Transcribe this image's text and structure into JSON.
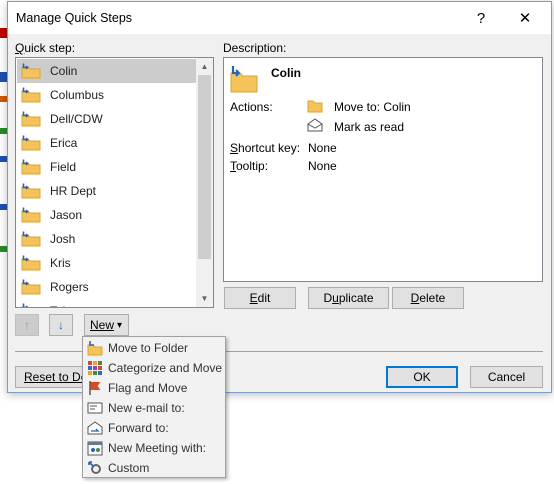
{
  "dialog": {
    "title": "Manage Quick Steps",
    "help_glyph": "?",
    "close_glyph": "✕"
  },
  "left": {
    "label_prefix": "",
    "label_hotkey": "Q",
    "label_rest": "uick step:",
    "items": [
      {
        "label": "Colin",
        "selected": true
      },
      {
        "label": "Columbus"
      },
      {
        "label": "Dell/CDW"
      },
      {
        "label": "Erica"
      },
      {
        "label": "Field"
      },
      {
        "label": "HR Dept"
      },
      {
        "label": "Jason"
      },
      {
        "label": "Josh"
      },
      {
        "label": "Kris"
      },
      {
        "label": "Rogers"
      },
      {
        "label": "Tobe"
      }
    ],
    "scroll_up": "▲",
    "scroll_down": "▼",
    "move_up_glyph": "↑",
    "move_down_glyph": "↓",
    "new_button": "New",
    "new_arrow": "▾",
    "reset_button": "Reset to Def"
  },
  "right": {
    "description_label": "Description:",
    "name": "Colin",
    "actions_label": "Actions:",
    "actions": [
      {
        "text": "Move to: Colin",
        "icon": "folder-icon"
      },
      {
        "text": "Mark as read",
        "icon": "envelope-open-icon"
      }
    ],
    "shortcut_hotkey": "S",
    "shortcut_rest": "hortcut key:",
    "shortcut_value": "None",
    "tooltip_hotkey": "T",
    "tooltip_rest": "ooltip:",
    "tooltip_value": "None",
    "edit_hotkey": "E",
    "edit_rest": "dit",
    "dup_prefix": "D",
    "dup_hotkey": "u",
    "dup_rest": "plicate",
    "delete_hotkey": "D",
    "delete_rest": "elete"
  },
  "footer": {
    "ok": "OK",
    "cancel": "Cancel"
  },
  "menu": {
    "items": [
      {
        "label": "Move to Folder",
        "icon": "folder-move-icon"
      },
      {
        "label": "Categorize and Move",
        "icon": "categorize-icon"
      },
      {
        "label": "Flag and Move",
        "icon": "flag-icon"
      },
      {
        "label": "New e-mail to:",
        "icon": "new-email-icon"
      },
      {
        "label": "Forward to:",
        "icon": "forward-icon"
      },
      {
        "label": "New Meeting with:",
        "icon": "meeting-icon"
      },
      {
        "label": "Custom",
        "icon": "custom-gear-icon"
      }
    ]
  },
  "colors": {
    "accent": "#0078d7",
    "selected_row": "#cccccc",
    "folder": "#f4c35a",
    "dialog_bg": "#f0f0f0"
  }
}
